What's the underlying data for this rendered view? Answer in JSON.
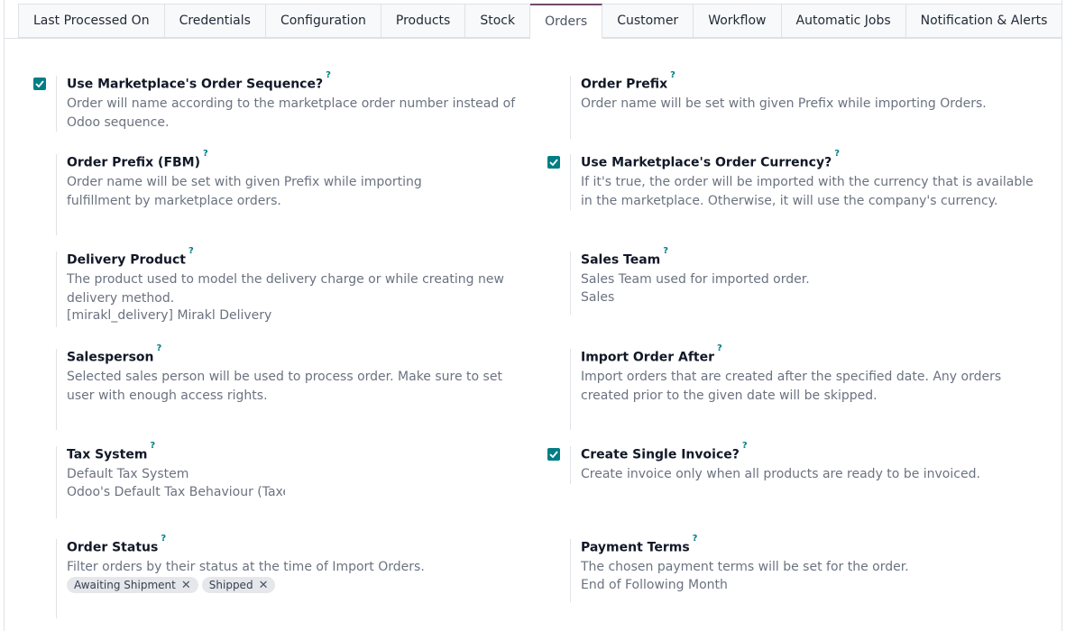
{
  "tabs": [
    {
      "label": "Last Processed On"
    },
    {
      "label": "Credentials"
    },
    {
      "label": "Configuration"
    },
    {
      "label": "Products"
    },
    {
      "label": "Stock"
    },
    {
      "label": "Orders",
      "active": true
    },
    {
      "label": "Customer"
    },
    {
      "label": "Workflow"
    },
    {
      "label": "Automatic Jobs"
    },
    {
      "label": "Notification & Alerts"
    }
  ],
  "help_mark": "?",
  "settings": {
    "use_marketplace_sequence": {
      "title": "Use Marketplace's Order Sequence?",
      "desc": "Order will name according to the marketplace order number instead of Odoo sequence.",
      "checked": true
    },
    "order_prefix": {
      "title": "Order Prefix",
      "desc": "Order name will be set with given Prefix while importing Orders."
    },
    "order_prefix_fbm": {
      "title": "Order Prefix (FBM)",
      "desc": "Order name will be set with given Prefix while importing fulfillment by marketplace orders."
    },
    "use_marketplace_currency": {
      "title": "Use Marketplace's Order Currency?",
      "desc": "If it's true, the order will be imported with the currency that is available in the marketplace. Otherwise, it will use the company's currency.",
      "checked": true
    },
    "delivery_product": {
      "title": "Delivery Product",
      "desc": "The product used to model the delivery charge or while creating new delivery method.",
      "value": "[mirakl_delivery] Mirakl Delivery"
    },
    "sales_team": {
      "title": "Sales Team",
      "desc": "Sales Team used for imported order.",
      "value": "Sales"
    },
    "salesperson": {
      "title": "Salesperson",
      "desc": "Selected sales person will be used to process order. Make sure to set user with enough access rights."
    },
    "import_order_after": {
      "title": "Import Order After",
      "desc": "Import orders that are created after the specified date. Any orders created prior to the given date will be skipped."
    },
    "tax_system": {
      "title": "Tax System",
      "desc": "Default Tax System",
      "value": "Odoo's Default Tax Behaviour (Taxes w"
    },
    "create_single_invoice": {
      "title": "Create Single Invoice?",
      "desc": "Create invoice only when all products are ready to be invoiced.",
      "checked": true
    },
    "order_status": {
      "title": "Order Status",
      "desc": "Filter orders by their status at the time of Import Orders.",
      "tags": [
        "Awaiting Shipment",
        "Shipped"
      ]
    },
    "payment_terms": {
      "title": "Payment Terms",
      "desc": "The chosen payment terms will be set for the order.",
      "value": "End of Following Month"
    }
  },
  "colors": {
    "accent": "#017e84",
    "active_tab": "#714b67"
  }
}
